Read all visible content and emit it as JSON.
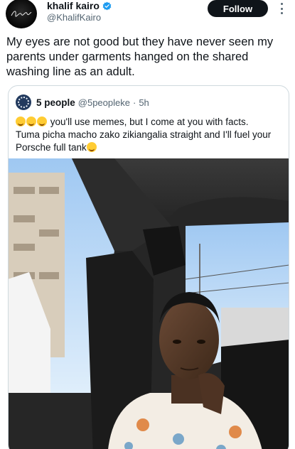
{
  "author": {
    "display_name": "khalif kairo",
    "handle": "@KhalifKairo",
    "verified": true,
    "avatar_icon": "signature-logo-avatar"
  },
  "actions": {
    "follow_label": "Follow",
    "more_icon": "more-vertical-icon"
  },
  "tweet": {
    "text": "My eyes are not good but they have never seen my parents under garments hanged on the shared washing line as an adult."
  },
  "quoted": {
    "display_name": "5 people",
    "handle": "@5peopleke",
    "separator": "·",
    "time": "5h",
    "emoji_prefix": [
      "laughing-emoji",
      "laughing-emoji",
      "laughing-emoji"
    ],
    "line1": "you'll use memes, but I come at you with facts.",
    "line2": "Tuma picha macho zako zikiangalia straight and I'll fuel your Porsche full tank",
    "emoji_suffix": "crying-emoji"
  },
  "colors": {
    "text": "#0f1419",
    "secondary": "#536471",
    "verified_blue": "#1d9bf0",
    "border": "#cfd9de"
  }
}
